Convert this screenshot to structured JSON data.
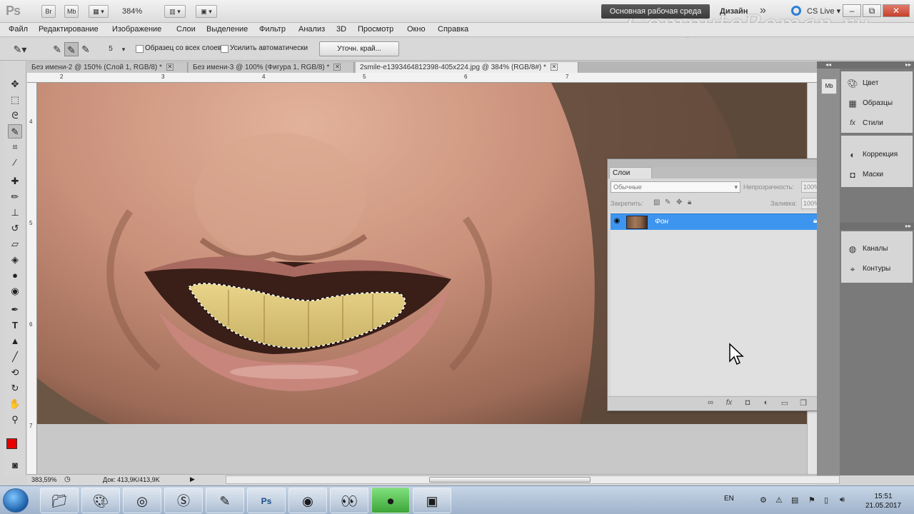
{
  "titlebar": {
    "app_logo": "Ps",
    "bridge_btn": "Br",
    "minibridge_btn": "Mb",
    "zoom": "384%",
    "workspace": "Основная рабочая среда",
    "design": "Дизайн",
    "cslive": "CS Live",
    "watermark": "ComputeRoman.ru"
  },
  "menu": {
    "items": [
      "Файл",
      "Редактирование",
      "Изображение",
      "Слои",
      "Выделение",
      "Фильтр",
      "Анализ",
      "3D",
      "Просмотр",
      "Окно",
      "Справка"
    ]
  },
  "options": {
    "brush_size": "5",
    "sample_all": "Образец со всех слоев",
    "auto_enhance": "Усилить автоматически",
    "refine_edge": "Уточн. край..."
  },
  "tabs": [
    {
      "title": "Без имени-2 @ 150% (Слой 1, RGB/8) *"
    },
    {
      "title": "Без имени-3 @ 100% (Фигура 1, RGB/8) *"
    },
    {
      "title": "2smile-e1393464812398-405x224.jpg @ 384% (RGB/8#) *"
    }
  ],
  "rulers": {
    "top": [
      "2",
      "3",
      "4",
      "5",
      "6",
      "7"
    ],
    "left": [
      "4",
      "5",
      "6",
      "7"
    ]
  },
  "status": {
    "zoom": "383,59%",
    "doc": "Док: 413,9K/413,9K"
  },
  "layers_panel": {
    "tab": "Слои",
    "blend_mode": "Обычные",
    "opacity_label": "Непрозрачность:",
    "opacity_value": "100%",
    "lock_label": "Закрепить:",
    "fill_label": "Заливка:",
    "fill_value": "100%",
    "layer_name": "Фон"
  },
  "dock": {
    "group1": [
      "Цвет",
      "Образцы",
      "Стили"
    ],
    "group2": [
      "Коррекция",
      "Маски"
    ],
    "group3": [
      "Каналы",
      "Контуры"
    ]
  },
  "taskbar": {
    "lang": "EN",
    "time": "15:51",
    "date": "21.05.2017"
  },
  "colors": {
    "foreground": "#e60000",
    "background": "#ffffff",
    "layer_selected": "#3d95f0",
    "workspace_btn": "#454545"
  }
}
